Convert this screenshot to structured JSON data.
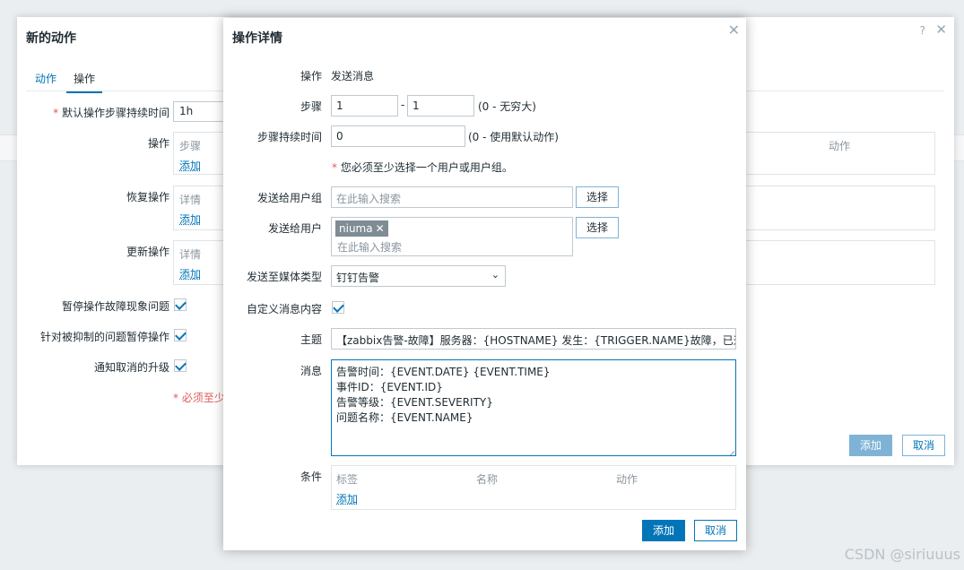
{
  "background_dialog": {
    "title": "新的动作",
    "help": "?",
    "close": "✕",
    "tabs": [
      "动作",
      "操作"
    ],
    "fields": {
      "default_duration_label": "默认操作步骤持续时间",
      "default_duration_value": "1h",
      "operations_label": "操作",
      "operations_head": "步骤",
      "operations_action_col": "动作",
      "operations_add": "添加",
      "recovery_label": "恢复操作",
      "recovery_head": "详情",
      "recovery_add": "添加",
      "update_label": "更新操作",
      "update_head": "详情",
      "update_add": "添加",
      "pause_problems_label": "暂停操作故障现象问题",
      "pause_suppressed_label": "针对被抑制的问题暂停操作",
      "notify_cancel_label": "通知取消的升级",
      "note": "* 必须至少"
    },
    "buttons": {
      "add": "添加",
      "cancel": "取消"
    }
  },
  "dialog": {
    "title": "操作详情",
    "close": "✕",
    "operation_label": "操作",
    "operation_value": "发送消息",
    "steps_label": "步骤",
    "steps_from": "1",
    "steps_sep": "-",
    "steps_to": "1",
    "steps_hint": "(0 - 无穷大)",
    "step_duration_label": "步骤持续时间",
    "step_duration_value": "0",
    "step_duration_hint": "(0 - 使用默认动作)",
    "required_note": "您必须至少选择一个用户或用户组。",
    "required_star": "*",
    "user_groups_label": "发送给用户组",
    "user_groups_placeholder": "在此输入搜索",
    "select_label": "选择",
    "users_label": "发送给用户",
    "user_tag": "niuma",
    "users_placeholder": "在此输入搜索",
    "media_type_label": "发送至媒体类型",
    "media_type_value": "钉钉告警",
    "custom_message_label": "自定义消息内容",
    "subject_label": "主题",
    "subject_value": "【zabbix告警-故障】服务器：{HOSTNAME} 发生：{TRIGGER.NAME}故障，已通知",
    "message_label": "消息",
    "message_value": "告警时间：{EVENT.DATE} {EVENT.TIME}\n事件ID：{EVENT.ID}\n告警等级：{EVENT.SEVERITY}\n问题名称：{EVENT.NAME}",
    "conditions_label": "条件",
    "conditions_columns": [
      "标签",
      "名称",
      "动作"
    ],
    "conditions_add": "添加",
    "buttons": {
      "add": "添加",
      "cancel": "取消"
    }
  },
  "watermark": "CSDN @siriuuus",
  "colors": {
    "accent": "#0275b8",
    "disabled_accent": "#7fb3d6",
    "required": "#e45959"
  }
}
